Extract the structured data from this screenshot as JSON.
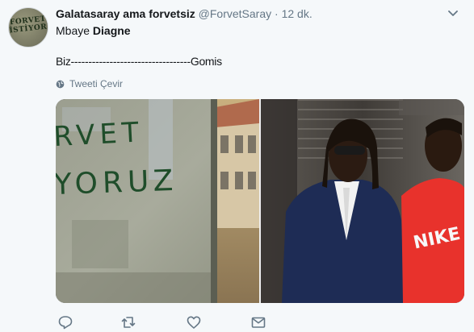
{
  "tweet": {
    "display_name": "Galatasaray ama forvetsiz",
    "handle": "@ForvetSaray",
    "separator": "·",
    "time": "12 dk.",
    "avatar_text_line1": "FORVET",
    "avatar_text_line2": "İSTİYORUZ",
    "line1_prefix": "Mbaye",
    "line1_bold": "Diagne",
    "line2": "Biz----------------------------------Gomis",
    "translate_label": "Tweeti Çevir",
    "photo_wall_text_line1": "RVET",
    "photo_wall_text_line2": "YORUZ",
    "photo_shirt_text": "NIKE"
  },
  "icons": {
    "reply": "reply-icon",
    "retweet": "retweet-icon",
    "like": "heart-icon",
    "dm": "envelope-icon",
    "caret": "chevron-down-icon",
    "globe": "globe-icon"
  },
  "colors": {
    "background": "#f5f8fa",
    "secondary_text": "#657786",
    "primary_text": "#14171a"
  }
}
